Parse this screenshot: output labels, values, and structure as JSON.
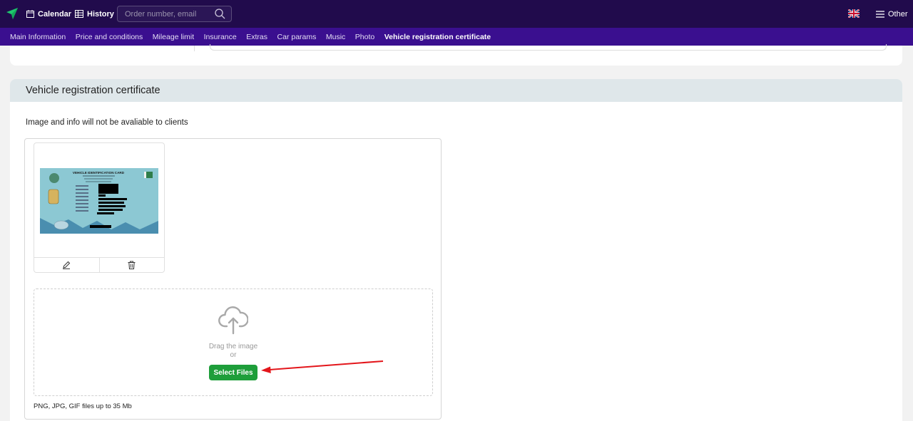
{
  "topbar": {
    "calendar_label": "Calendar",
    "history_label": "History",
    "search_placeholder": "Order number, email",
    "other_label": "Other"
  },
  "subnav": {
    "items": [
      {
        "label": "Main Information"
      },
      {
        "label": "Price and conditions"
      },
      {
        "label": "Mileage limit"
      },
      {
        "label": "Insurance"
      },
      {
        "label": "Extras"
      },
      {
        "label": "Car params"
      },
      {
        "label": "Music"
      },
      {
        "label": "Photo"
      },
      {
        "label": "Vehicle registration certificate",
        "active": true
      }
    ]
  },
  "section": {
    "title": "Vehicle registration certificate",
    "note": "Image and info will not be avaliable to clients",
    "thumbnail": {
      "card_heading": "VEHICLE IDENTIFICATION CARD"
    },
    "dropzone": {
      "drag_text": "Drag the image",
      "or_text": "or",
      "button_label": "Select Files"
    },
    "hint": "PNG, JPG, GIF files up to 35 Mb"
  },
  "colors": {
    "topbar_bg": "#210b4c",
    "subnav_bg": "#3a0f8f",
    "button_green": "#1e9e3a",
    "arrow_red": "#e3161b"
  }
}
